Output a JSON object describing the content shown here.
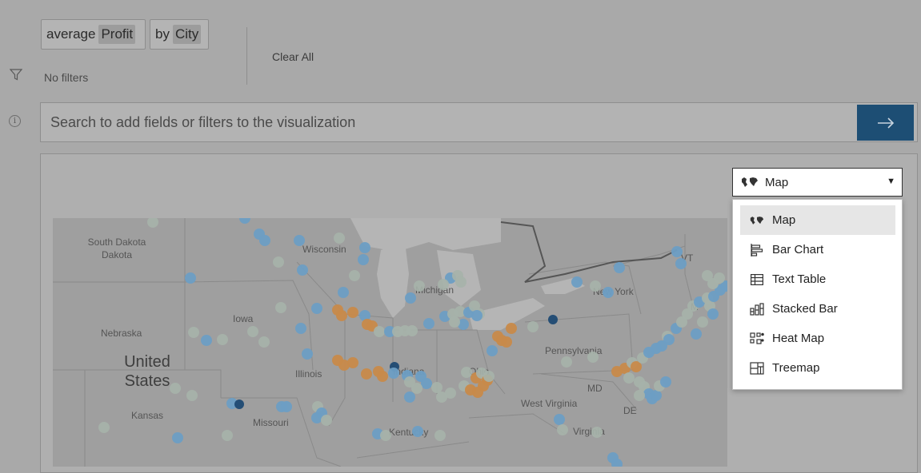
{
  "shelf": {
    "measure": {
      "prefix": "average",
      "field": "Profit"
    },
    "dimension": {
      "prefix": "by",
      "field": "City"
    }
  },
  "filters": {
    "empty_text": "No filters"
  },
  "clear_all_label": "Clear All",
  "search": {
    "placeholder": "Search to add fields or filters to the visualization",
    "value": "",
    "submit_icon": "arrow-right-icon"
  },
  "viz_selector": {
    "selected_label": "Map",
    "selected_icon": "map-icon"
  },
  "viz_menu": {
    "items": [
      {
        "label": "Map",
        "icon": "map-icon",
        "selected": true
      },
      {
        "label": "Bar Chart",
        "icon": "bar-chart-icon",
        "selected": false
      },
      {
        "label": "Text Table",
        "icon": "text-table-icon",
        "selected": false
      },
      {
        "label": "Stacked Bar",
        "icon": "stacked-bar-icon",
        "selected": false
      },
      {
        "label": "Heat Map",
        "icon": "heat-map-icon",
        "selected": false
      },
      {
        "label": "Treemap",
        "icon": "treemap-icon",
        "selected": false
      }
    ]
  },
  "map": {
    "labels": [
      "South Dakota",
      "Wisconsin",
      "Michigan",
      "New York",
      "Iowa",
      "Nebraska",
      "United States",
      "Illinois",
      "Indiana",
      "Ohio",
      "Pennsylvania",
      "Kansas",
      "Missouri",
      "West Virginia",
      "Kentucky",
      "Virginia",
      "VT",
      "MD",
      "DE",
      "M"
    ],
    "colors": {
      "low": "#6d9ec4",
      "high": "#c88a4a",
      "dark": "#1f4a73",
      "light": "#a6b2aa"
    }
  },
  "colors": {
    "accent": "#1d4e74",
    "overlay": "#a9a9a9"
  }
}
